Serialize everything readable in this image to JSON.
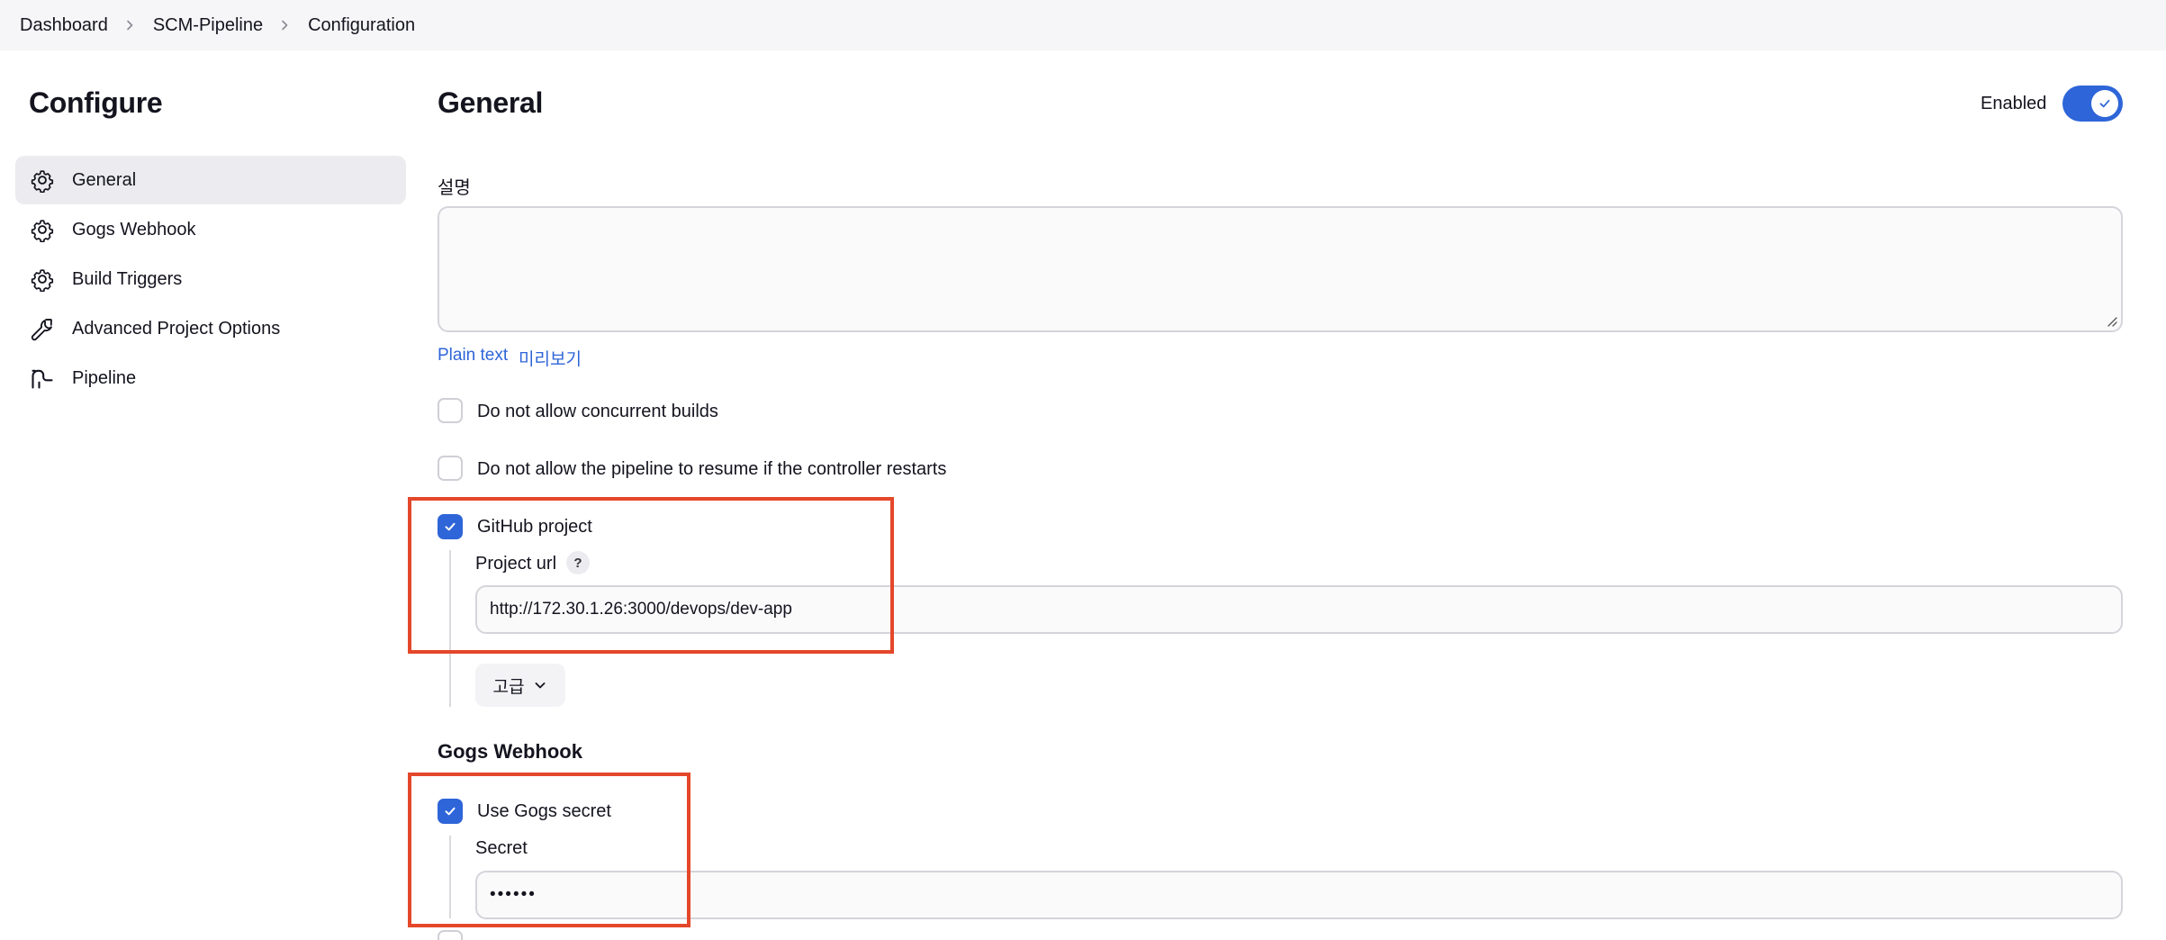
{
  "breadcrumb": {
    "items": [
      "Dashboard",
      "SCM-Pipeline",
      "Configuration"
    ]
  },
  "sidebar": {
    "title": "Configure",
    "items": [
      {
        "label": "General",
        "icon": "gear-icon",
        "active": true
      },
      {
        "label": "Gogs Webhook",
        "icon": "gear-icon"
      },
      {
        "label": "Build Triggers",
        "icon": "gear-icon"
      },
      {
        "label": "Advanced Project Options",
        "icon": "wrench-icon"
      },
      {
        "label": "Pipeline",
        "icon": "pipeline-icon"
      }
    ]
  },
  "general": {
    "title": "General",
    "enabled_label": "Enabled",
    "enabled": true,
    "description_label": "설명",
    "description_value": "",
    "plain_text_link": "Plain text",
    "preview_link": "미리보기",
    "checkboxes": {
      "concurrent": {
        "label": "Do not allow concurrent builds",
        "checked": false
      },
      "resume": {
        "label": "Do not allow the pipeline to resume if the controller restarts",
        "checked": false
      },
      "github": {
        "label": "GitHub project",
        "checked": true
      }
    },
    "project_url_label": "Project url",
    "help_glyph": "?",
    "project_url_value": "http://172.30.1.26:3000/devops/dev-app",
    "advanced_button": "고급"
  },
  "gogs": {
    "title": "Gogs Webhook",
    "use_secret": {
      "label": "Use Gogs secret",
      "checked": true
    },
    "secret_label": "Secret",
    "secret_value": "••••••"
  },
  "colors": {
    "accent": "#2e65d8",
    "highlight": "#e4472a"
  }
}
